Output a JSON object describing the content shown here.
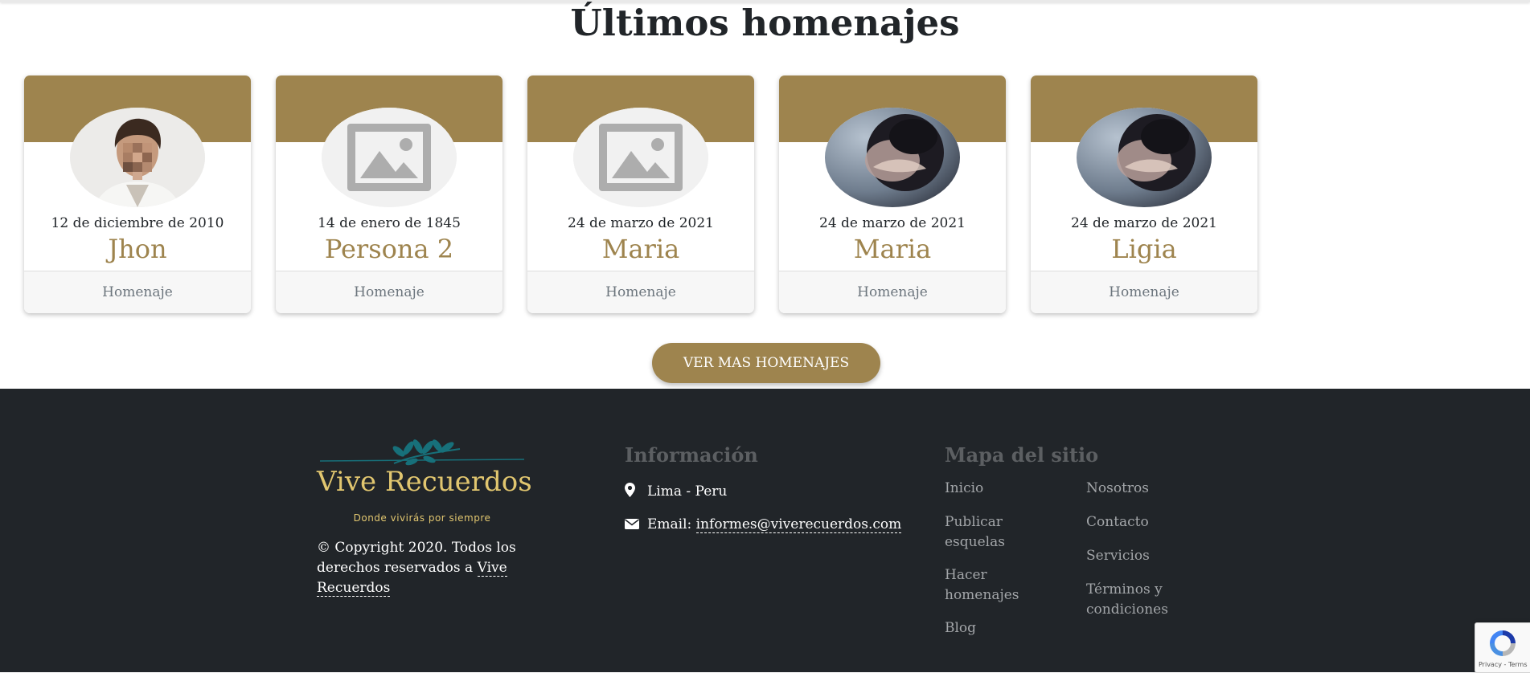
{
  "section": {
    "title": "Últimos homenajes"
  },
  "cards": [
    {
      "date": "12 de diciembre de 2010",
      "name": "Jhon",
      "link": "Homenaje",
      "photo": "portrait-man"
    },
    {
      "date": "14 de enero de 1845",
      "name": "Persona 2",
      "link": "Homenaje",
      "photo": "image-placeholder"
    },
    {
      "date": "24 de marzo de 2021",
      "name": "Maria",
      "link": "Homenaje",
      "photo": "image-placeholder"
    },
    {
      "date": "24 de marzo de 2021",
      "name": "Maria",
      "link": "Homenaje",
      "photo": "portrait-woman-blurred"
    },
    {
      "date": "24 de marzo de 2021",
      "name": "Ligia",
      "link": "Homenaje",
      "photo": "portrait-woman-blurred"
    }
  ],
  "more_button": {
    "label": "VER MAS HOMENAJES"
  },
  "footer": {
    "logo": {
      "text": "Vive Recuerdos",
      "tagline": "Donde vivirás por siempre"
    },
    "copyright": {
      "prefix": "© Copyright 2020. Todos los derechos reservados a ",
      "link": "Vive Recuerdos"
    },
    "info": {
      "heading": "Información",
      "location": "Lima - Peru",
      "email_label": "Email: ",
      "email": "informes@viverecuerdos.com"
    },
    "sitemap": {
      "heading": "Mapa del sitio",
      "col1": [
        "Inicio",
        "Publicar esquelas",
        "Hacer homenajes",
        "Blog"
      ],
      "col2": [
        "Nosotros",
        "Contacto",
        "Servicios",
        "Términos y condiciones"
      ]
    }
  },
  "recaptcha": {
    "text": "Privacy - Terms"
  },
  "colors": {
    "brand_gold": "#9e844e",
    "logo_gold": "#e1c66f",
    "footer_bg": "#212529",
    "logo_teal": "#17707a"
  }
}
